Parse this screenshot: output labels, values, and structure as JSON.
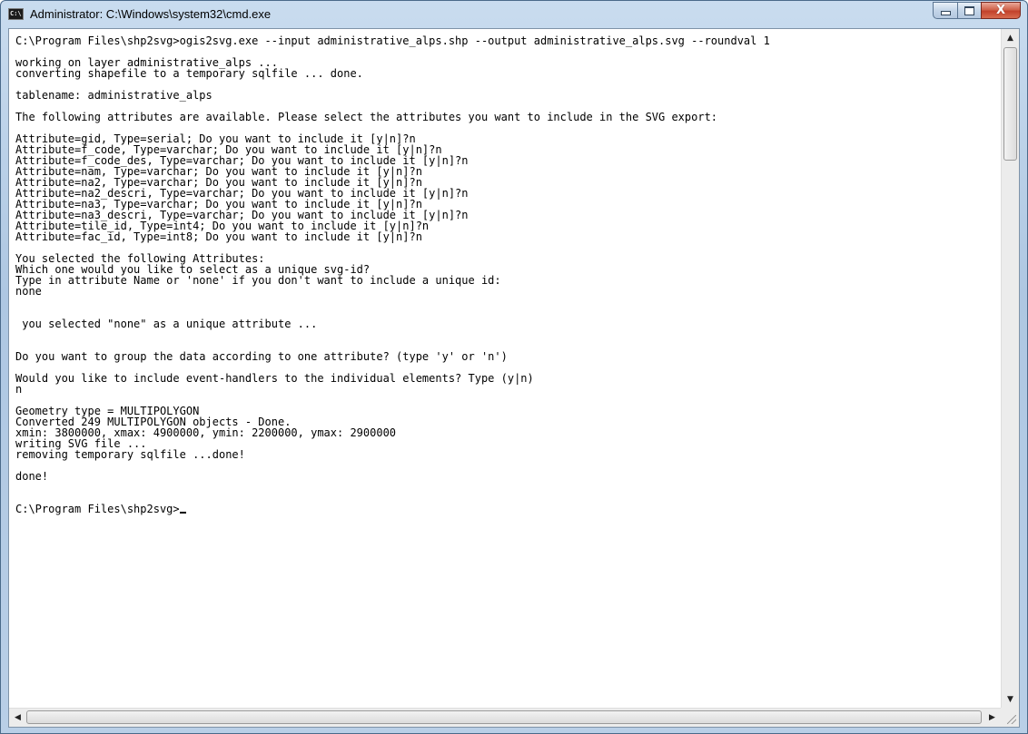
{
  "window": {
    "title": "Administrator: C:\\Windows\\system32\\cmd.exe",
    "icon": "cmd-icon",
    "icon_text": "C:\\",
    "buttons": {
      "minimize_icon": "minimize-icon",
      "maximize_icon": "maximize-icon",
      "close_icon": "close-icon",
      "close_glyph": "X"
    }
  },
  "console": {
    "lines": [
      "C:\\Program Files\\shp2svg>ogis2svg.exe --input administrative_alps.shp --output administrative_alps.svg --roundval 1",
      "",
      "working on layer administrative_alps ...",
      "converting shapefile to a temporary sqlfile ... done.",
      "",
      "tablename: administrative_alps",
      "",
      "The following attributes are available. Please select the attributes you want to include in the SVG export:",
      "",
      "Attribute=gid, Type=serial; Do you want to include it [y|n]?n",
      "Attribute=f_code, Type=varchar; Do you want to include it [y|n]?n",
      "Attribute=f_code_des, Type=varchar; Do you want to include it [y|n]?n",
      "Attribute=nam, Type=varchar; Do you want to include it [y|n]?n",
      "Attribute=na2, Type=varchar; Do you want to include it [y|n]?n",
      "Attribute=na2_descri, Type=varchar; Do you want to include it [y|n]?n",
      "Attribute=na3, Type=varchar; Do you want to include it [y|n]?n",
      "Attribute=na3_descri, Type=varchar; Do you want to include it [y|n]?n",
      "Attribute=tile_id, Type=int4; Do you want to include it [y|n]?n",
      "Attribute=fac_id, Type=int8; Do you want to include it [y|n]?n",
      "",
      "You selected the following Attributes:",
      "Which one would you like to select as a unique svg-id?",
      "Type in attribute Name or 'none' if you don't want to include a unique id:",
      "none",
      "",
      "",
      " you selected \"none\" as a unique attribute ...",
      "",
      "",
      "Do you want to group the data according to one attribute? (type 'y' or 'n')",
      "",
      "Would you like to include event-handlers to the individual elements? Type (y|n)",
      "n",
      "",
      "Geometry type = MULTIPOLYGON",
      "Converted 249 MULTIPOLYGON objects - Done.",
      "xmin: 3800000, xmax: 4900000, ymin: 2200000, ymax: 2900000",
      "writing SVG file ...",
      "removing temporary sqlfile ...done!",
      "",
      "done!",
      "",
      "",
      "C:\\Program Files\\shp2svg>"
    ]
  },
  "scrollbars": {
    "vertical_up_icon": "scroll-up-arrow-icon",
    "vertical_down_icon": "scroll-down-arrow-icon",
    "horizontal_left_icon": "scroll-left-arrow-icon",
    "horizontal_right_icon": "scroll-right-arrow-icon"
  }
}
